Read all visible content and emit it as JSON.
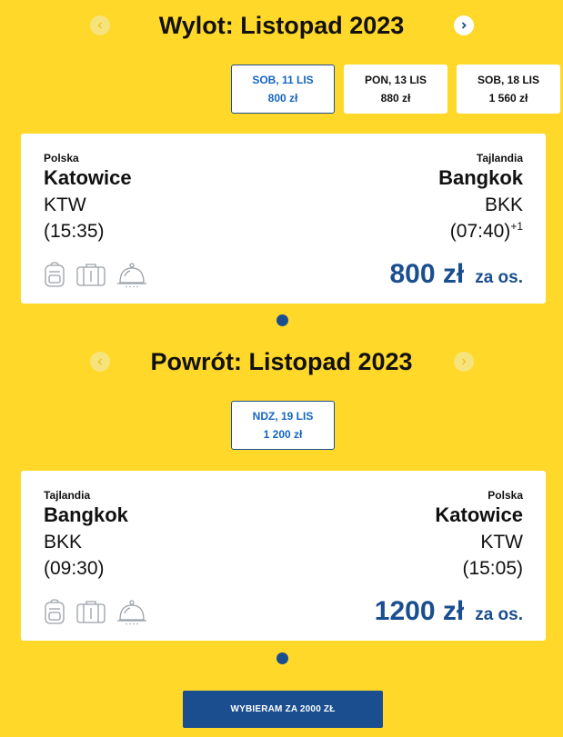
{
  "outbound": {
    "title": "Wylot: Listopad 2023",
    "dates": [
      {
        "day": "SOB, 11 LIS",
        "price": "800 zł",
        "selected": true
      },
      {
        "day": "PON, 13 LIS",
        "price": "880 zł",
        "selected": false
      },
      {
        "day": "SOB, 18 LIS",
        "price": "1 560 zł",
        "selected": false
      }
    ],
    "flight": {
      "from_country": "Polska",
      "from_city": "Katowice",
      "from_code": "KTW",
      "from_time": "(15:35)",
      "to_country": "Tajlandia",
      "to_city": "Bangkok",
      "to_code": "BKK",
      "to_time": "(07:40)",
      "to_day_offset": "+1",
      "price": "800 zł",
      "per_person": "za os."
    }
  },
  "inbound": {
    "title": "Powrót: Listopad 2023",
    "dates": [
      {
        "day": "NDZ, 19 LIS",
        "price": "1 200 zł",
        "selected": true
      }
    ],
    "flight": {
      "from_country": "Tajlandia",
      "from_city": "Bangkok",
      "from_code": "BKK",
      "from_time": "(09:30)",
      "to_country": "Polska",
      "to_city": "Katowice",
      "to_code": "KTW",
      "to_time": "(15:05)",
      "price": "1200 zł",
      "per_person": "za os."
    }
  },
  "cta_label": "WYBIERAM ZA 2000 ZŁ",
  "colors": {
    "background": "#ffd829",
    "accent": "#1a4e8f",
    "selected_text": "#1565c0"
  },
  "icons": [
    "backpack-icon",
    "suitcase-icon",
    "meal-icon",
    "chevron-left-icon",
    "chevron-right-icon"
  ]
}
